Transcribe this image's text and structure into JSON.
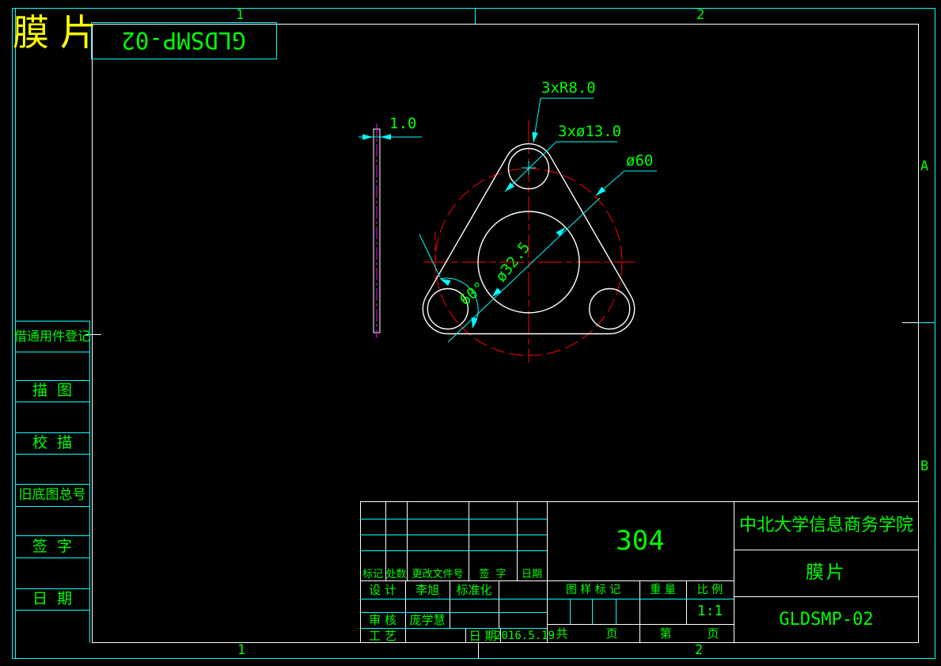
{
  "zones": {
    "top_left": "1",
    "top_right": "2",
    "bottom_left": "1",
    "bottom_right": "2",
    "right_upper": "A",
    "right_lower": "B"
  },
  "corner": {
    "part_name": "膜片",
    "drawing_no_flipped": "GLDSMP-02"
  },
  "sidebar": {
    "items": [
      {
        "label": "借通用件登记"
      },
      {
        "label": "描  图"
      },
      {
        "label": "校  描"
      },
      {
        "label": "旧底图总号"
      },
      {
        "label": "签  字"
      },
      {
        "label": "日  期"
      }
    ]
  },
  "dimensions": {
    "thickness": "1.0",
    "corner_radius": "3xR8.0",
    "hole_diameter": "3xø13.0",
    "bolt_circle_diameter": "ø60",
    "center_hole_diameter": "ø32.5",
    "hole_angle": "60°"
  },
  "title_block": {
    "material": "304",
    "school": "中北大学信息商务学院",
    "part_name": "膜片",
    "drawing_no": "GLDSMP-02",
    "header": {
      "mark": "标记",
      "count": "处数",
      "change_doc_no": "更改文件号",
      "sign": "签  字",
      "date": "日期"
    },
    "rows": {
      "design_label": "设 计",
      "designer": "李旭",
      "standard_label": "标准化",
      "check_label": "审 核",
      "checker": "庞学慧",
      "process_label": "工 艺",
      "date_label": "日 期",
      "date_value": "2016.5.19"
    },
    "stamp": {
      "mark_label": "图 样 标 记",
      "weight_label": "重 量",
      "scale_label": "比 例",
      "scale_value": "1:1",
      "total_label": "共",
      "total_pages_word": "页",
      "page_label": "第",
      "page_word": "页"
    }
  },
  "colors": {
    "outline": "#ffffff",
    "frame": "#00ffff",
    "annotation": "#00ff00",
    "centerline": "#ff0000",
    "hidden_line": "#ff00ff",
    "corner_title": "#ffff00"
  }
}
